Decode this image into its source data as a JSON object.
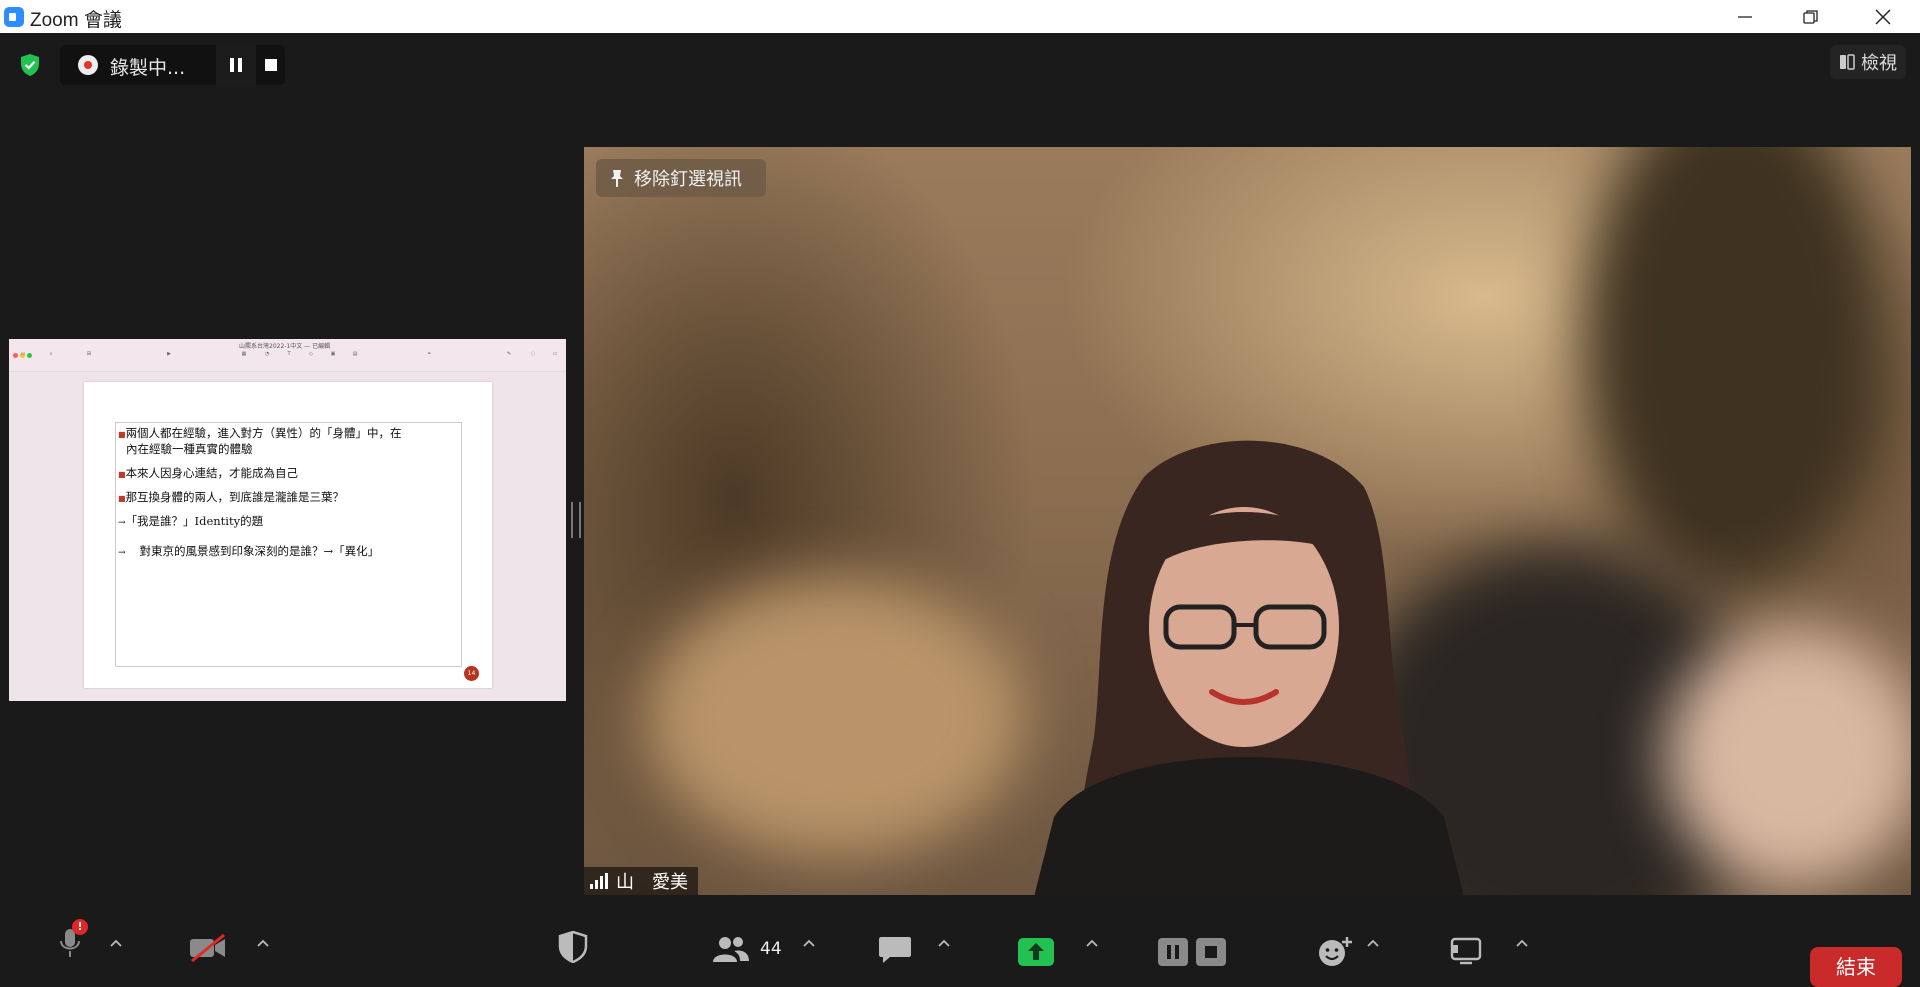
{
  "window": {
    "title": "Zoom 會議",
    "controls": [
      "minimize-icon",
      "restore-icon",
      "close-icon"
    ]
  },
  "top_bar": {
    "recording_label": "錄製中...",
    "view_label": "檢視",
    "icons": [
      "security-shield-icon",
      "record-icon",
      "pause-icon",
      "stop-icon",
      "view-layout-icon"
    ]
  },
  "shared_content": {
    "app_title": "山羆系台灣2022-1中文 — 已編輯",
    "slide_lines": [
      "兩個人都在經驗，進入對方（異性）的「身體」中，在",
      "內在經驗一種真實的體驗",
      "本來人因身心連結，才能成為自己",
      "那互換身體的兩人，到底誰是瀧誰是三葉？",
      "「我是誰？」Identity的題",
      "對東京的風景感到印象深刻的是誰？→「異化」"
    ],
    "slide_number": "14"
  },
  "video": {
    "unpin_label": "移除釘選視訊",
    "participant_name": "山　愛美"
  },
  "toolbar": {
    "participants_count": "44",
    "unmute_badge": "!",
    "end_label": "結束",
    "colors": {
      "share_green": "#23c152",
      "end_red": "#c92b2b",
      "badge_red": "#e02828"
    }
  }
}
